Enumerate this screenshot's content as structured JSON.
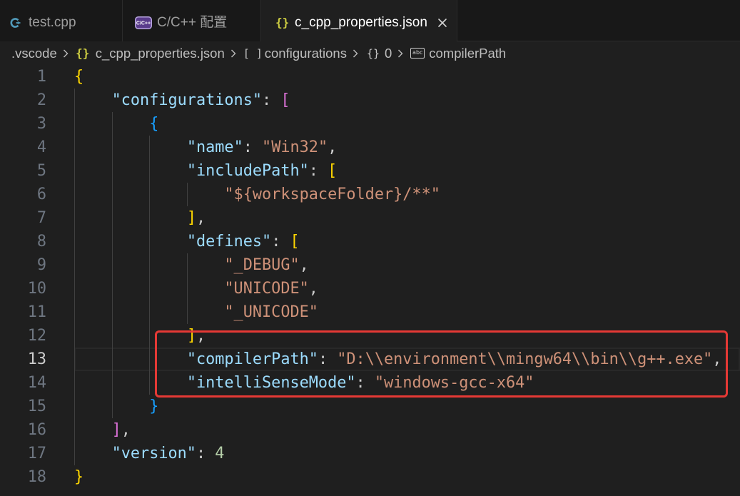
{
  "tabs": [
    {
      "label": "test.cpp",
      "icon": "cpp-file-icon",
      "active": false
    },
    {
      "label": "C/C++ 配置",
      "icon": "cpp-extension-icon",
      "icon_text": "C/C++",
      "active": false
    },
    {
      "label": "c_cpp_properties.json",
      "icon": "json-file-icon",
      "icon_glyph": "{}",
      "active": true,
      "closable": true
    }
  ],
  "breadcrumb": [
    {
      "label": ".vscode"
    },
    {
      "label": "c_cpp_properties.json",
      "icon": "json-file-icon",
      "icon_glyph": "{}"
    },
    {
      "label": "configurations",
      "icon": "symbol-array-icon",
      "icon_glyph": "[ ]"
    },
    {
      "label": "0",
      "icon": "symbol-object-icon",
      "icon_glyph": "{}"
    },
    {
      "label": "compilerPath",
      "icon": "symbol-string-icon",
      "icon_glyph": "abc"
    }
  ],
  "editor": {
    "active_line": 13,
    "syntax_colors": {
      "json-key": "#9cdcfe",
      "json-string": "#ce9178",
      "json-number": "#b5cea8",
      "punctuation": "#cccccc",
      "bracket-level-1": "#ffd700",
      "bracket-level-2": "#da70d6",
      "bracket-level-3": "#179fff"
    },
    "lines": [
      {
        "n": 1,
        "indent": 0,
        "tokens": [
          {
            "t": "{",
            "c": "bracket-level-1"
          }
        ]
      },
      {
        "n": 2,
        "indent": 4,
        "tokens": [
          {
            "t": "\"configurations\"",
            "c": "json-key"
          },
          {
            "t": ": ",
            "c": "punctuation"
          },
          {
            "t": "[",
            "c": "bracket-level-2"
          }
        ]
      },
      {
        "n": 3,
        "indent": 8,
        "tokens": [
          {
            "t": "{",
            "c": "bracket-level-3"
          }
        ]
      },
      {
        "n": 4,
        "indent": 12,
        "tokens": [
          {
            "t": "\"name\"",
            "c": "json-key"
          },
          {
            "t": ": ",
            "c": "punctuation"
          },
          {
            "t": "\"Win32\"",
            "c": "json-string"
          },
          {
            "t": ",",
            "c": "punctuation"
          }
        ]
      },
      {
        "n": 5,
        "indent": 12,
        "tokens": [
          {
            "t": "\"includePath\"",
            "c": "json-key"
          },
          {
            "t": ": ",
            "c": "punctuation"
          },
          {
            "t": "[",
            "c": "bracket-level-1"
          }
        ]
      },
      {
        "n": 6,
        "indent": 16,
        "tokens": [
          {
            "t": "\"${workspaceFolder}/**\"",
            "c": "json-string"
          }
        ]
      },
      {
        "n": 7,
        "indent": 12,
        "tokens": [
          {
            "t": "]",
            "c": "bracket-level-1"
          },
          {
            "t": ",",
            "c": "punctuation"
          }
        ]
      },
      {
        "n": 8,
        "indent": 12,
        "tokens": [
          {
            "t": "\"defines\"",
            "c": "json-key"
          },
          {
            "t": ": ",
            "c": "punctuation"
          },
          {
            "t": "[",
            "c": "bracket-level-1"
          }
        ]
      },
      {
        "n": 9,
        "indent": 16,
        "tokens": [
          {
            "t": "\"_DEBUG\"",
            "c": "json-string"
          },
          {
            "t": ",",
            "c": "punctuation"
          }
        ]
      },
      {
        "n": 10,
        "indent": 16,
        "tokens": [
          {
            "t": "\"UNICODE\"",
            "c": "json-string"
          },
          {
            "t": ",",
            "c": "punctuation"
          }
        ]
      },
      {
        "n": 11,
        "indent": 16,
        "tokens": [
          {
            "t": "\"_UNICODE\"",
            "c": "json-string"
          }
        ]
      },
      {
        "n": 12,
        "indent": 12,
        "tokens": [
          {
            "t": "]",
            "c": "bracket-level-1"
          },
          {
            "t": ",",
            "c": "punctuation"
          }
        ]
      },
      {
        "n": 13,
        "indent": 12,
        "tokens": [
          {
            "t": "\"compilerPath\"",
            "c": "json-key"
          },
          {
            "t": ": ",
            "c": "punctuation"
          },
          {
            "t": "\"D:\\\\environment\\\\mingw64\\\\bin\\\\g++.exe\"",
            "c": "json-string"
          },
          {
            "t": ",",
            "c": "punctuation"
          }
        ]
      },
      {
        "n": 14,
        "indent": 12,
        "tokens": [
          {
            "t": "\"intelliSenseMode\"",
            "c": "json-key"
          },
          {
            "t": ": ",
            "c": "punctuation"
          },
          {
            "t": "\"windows-gcc-x64\"",
            "c": "json-string"
          }
        ]
      },
      {
        "n": 15,
        "indent": 8,
        "tokens": [
          {
            "t": "}",
            "c": "bracket-level-3"
          }
        ]
      },
      {
        "n": 16,
        "indent": 4,
        "tokens": [
          {
            "t": "]",
            "c": "bracket-level-2"
          },
          {
            "t": ",",
            "c": "punctuation"
          }
        ]
      },
      {
        "n": 17,
        "indent": 4,
        "tokens": [
          {
            "t": "\"version\"",
            "c": "json-key"
          },
          {
            "t": ": ",
            "c": "punctuation"
          },
          {
            "t": "4",
            "c": "json-number"
          }
        ]
      },
      {
        "n": 18,
        "indent": 0,
        "tokens": [
          {
            "t": "}",
            "c": "bracket-level-1"
          }
        ]
      }
    ]
  },
  "annotation": {
    "color": "#e53935"
  }
}
